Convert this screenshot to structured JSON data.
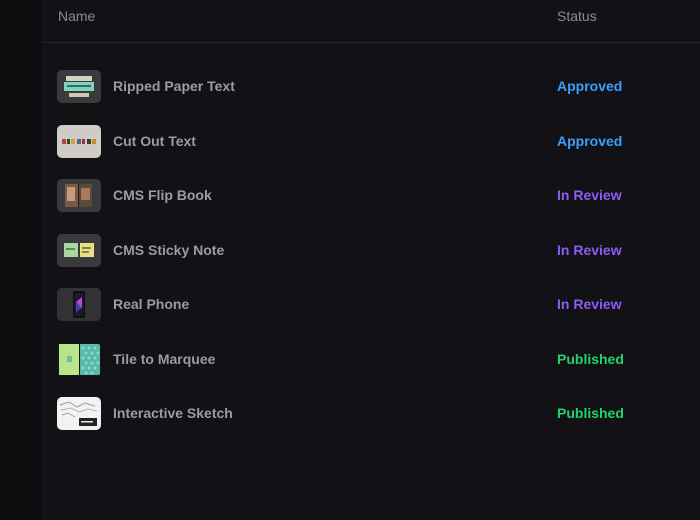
{
  "header": {
    "name_label": "Name",
    "status_label": "Status"
  },
  "status_colors": {
    "Approved": "#3aa0ff",
    "In Review": "#8b5cf6",
    "Published": "#22d36b"
  },
  "rows": [
    {
      "name": "Ripped Paper Text",
      "status": "Approved",
      "icon": "ripped-paper-thumbnail"
    },
    {
      "name": "Cut Out Text",
      "status": "Approved",
      "icon": "cut-out-text-thumbnail"
    },
    {
      "name": "CMS Flip Book",
      "status": "In Review",
      "icon": "flip-book-thumbnail"
    },
    {
      "name": "CMS Sticky Note",
      "status": "In Review",
      "icon": "sticky-note-thumbnail"
    },
    {
      "name": "Real Phone",
      "status": "In Review",
      "icon": "phone-thumbnail"
    },
    {
      "name": "Tile to Marquee",
      "status": "Published",
      "icon": "tile-marquee-thumbnail"
    },
    {
      "name": "Interactive Sketch",
      "status": "Published",
      "icon": "sketch-thumbnail"
    }
  ]
}
